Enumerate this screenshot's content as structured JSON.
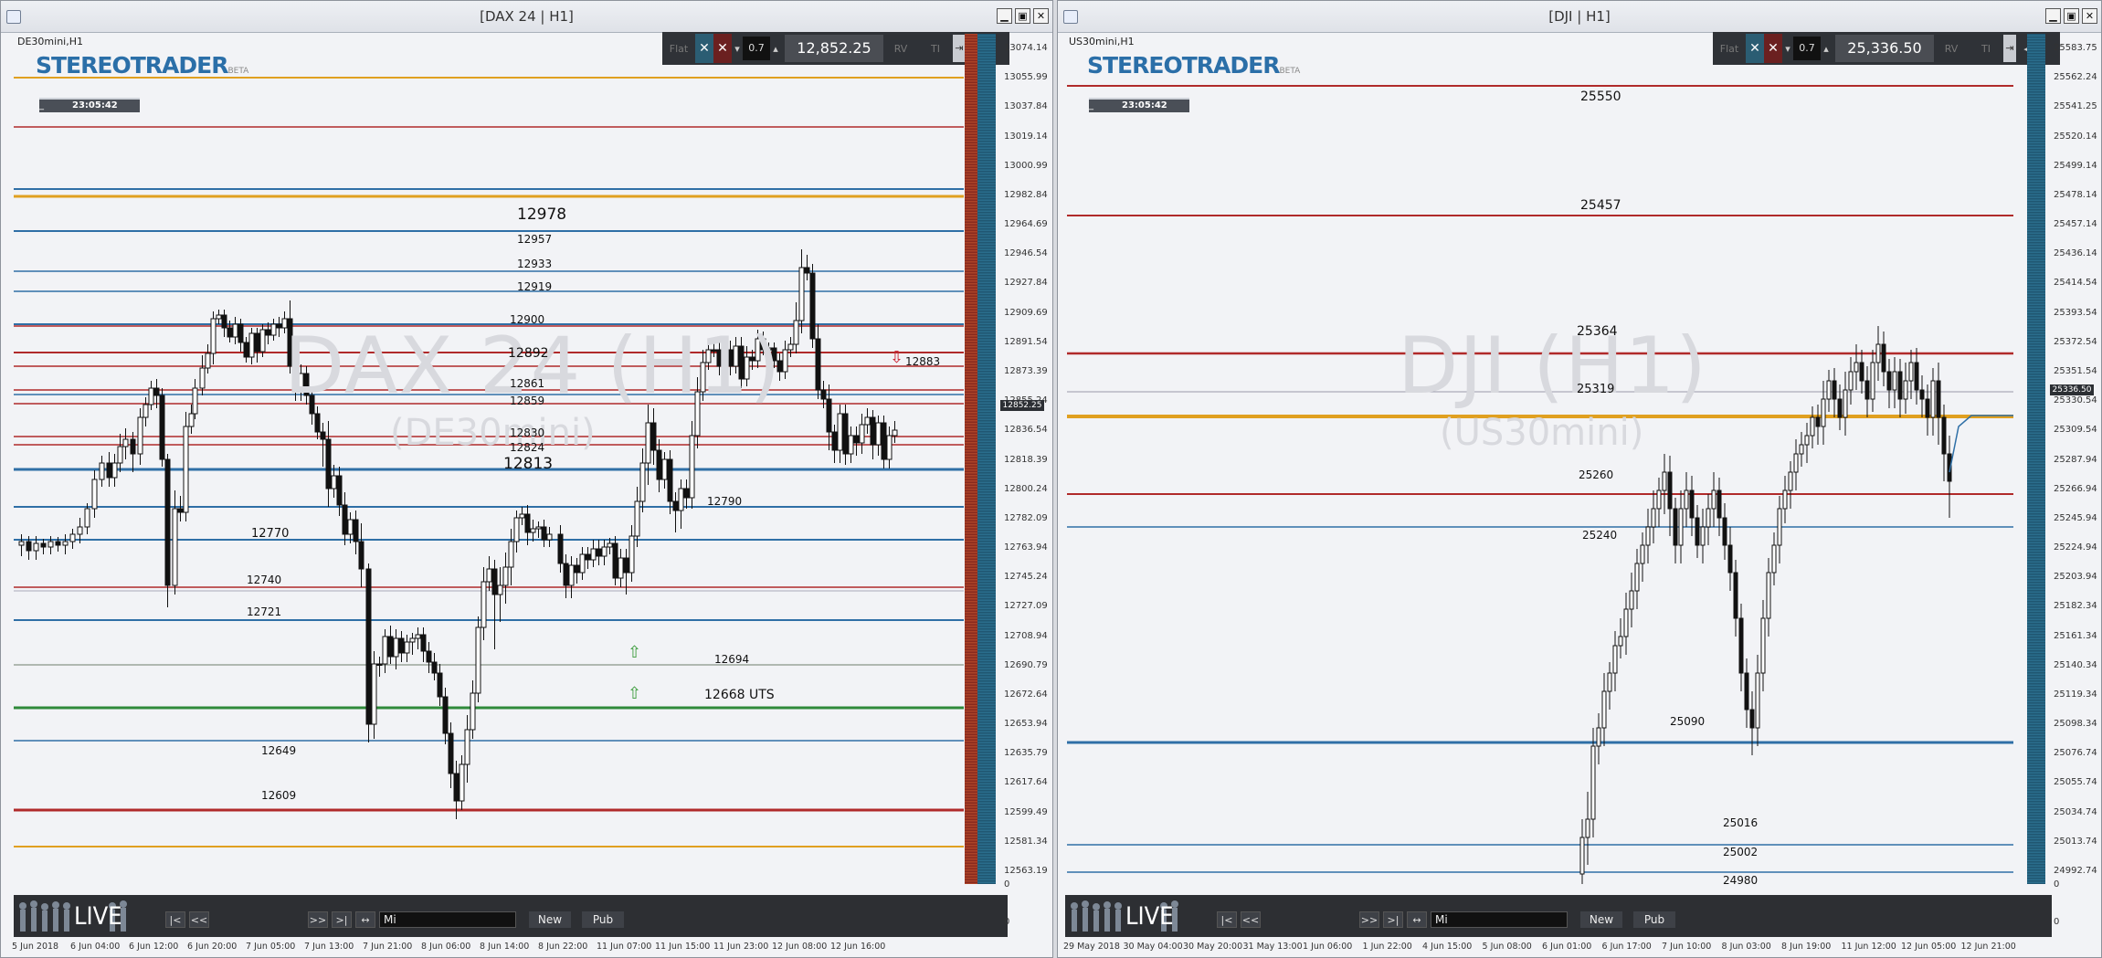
{
  "left": {
    "title": "[DAX 24 | H1]",
    "symbol": "DE30mini,H1",
    "watermark": "DAX 24 (H1)",
    "watermark_sub": "(DE30mini)",
    "logo_text": "STEREOTRADER",
    "logo_sub": "BETA",
    "clock": "23:05:42",
    "toolbar": {
      "flat": "Flat",
      "x1": "✕",
      "x2": "✕",
      "qty": "0.7",
      "price": "12,852.25",
      "rv": "RV",
      "ti": "TI"
    },
    "current_price_tag": "12852.25",
    "yaxis": [
      "13074.14",
      "13055.99",
      "13037.84",
      "13019.14",
      "13000.99",
      "12982.84",
      "12964.69",
      "12946.54",
      "12927.84",
      "12909.69",
      "12891.54",
      "12873.39",
      "12855.24",
      "12836.54",
      "12818.39",
      "12800.24",
      "12782.09",
      "12763.94",
      "12745.24",
      "12727.09",
      "12708.94",
      "12690.79",
      "12672.64",
      "12653.94",
      "12635.79",
      "12617.64",
      "12599.49",
      "12581.34",
      "12563.19"
    ],
    "levels": [
      {
        "value": "12978",
        "color": "#2f6fa6",
        "big": true
      },
      {
        "value": "12957",
        "color": "#2f6fa6"
      },
      {
        "value": "12933",
        "color": "#2f6fa6"
      },
      {
        "value": "12919",
        "color": "#2f6fa6"
      },
      {
        "value": "12900",
        "color": "#b02a2a"
      },
      {
        "value": "12892",
        "color": "#b02a2a"
      },
      {
        "value": "12883",
        "color": "#b02a2a"
      },
      {
        "value": "12861",
        "color": "#b02a2a"
      },
      {
        "value": "12859",
        "color": "#b02a2a"
      },
      {
        "value": "12830",
        "color": "#b02a2a"
      },
      {
        "value": "12824",
        "color": "#b02a2a"
      },
      {
        "value": "12813",
        "color": "#2f6fa6",
        "big": true
      },
      {
        "value": "12790",
        "color": "#2f6fa6"
      },
      {
        "value": "12770",
        "color": "#2f6fa6"
      },
      {
        "value": "12740",
        "color": "#b02a2a"
      },
      {
        "value": "12721",
        "color": "#2f6fa6"
      },
      {
        "value": "12694",
        "color": "#9aa49a"
      },
      {
        "value": "12668 UTS",
        "color": "#2f8a3a"
      },
      {
        "value": "12649",
        "color": "#2f6fa6"
      },
      {
        "value": "12609",
        "color": "#b02a2a"
      }
    ],
    "xaxis": [
      "5 Jun 2018",
      "6 Jun 04:00",
      "6 Jun 12:00",
      "6 Jun 20:00",
      "7 Jun 05:00",
      "7 Jun 13:00",
      "7 Jun 21:00",
      "8 Jun 06:00",
      "8 Jun 14:00",
      "8 Jun 22:00",
      "11 Jun 07:00",
      "11 Jun 15:00",
      "11 Jun 23:00",
      "12 Jun 08:00",
      "12 Jun 16:00"
    ],
    "bottom": {
      "live": "LIVE",
      "first": "|<",
      "prev": "<<",
      "next": ">>",
      "last": ">|",
      "expand": "↔",
      "input": "Mi",
      "new": "New",
      "pub": "Pub"
    },
    "gauge_values": [
      "0",
      "0"
    ]
  },
  "right": {
    "title": "[DJI | H1]",
    "symbol": "US30mini,H1",
    "watermark": "DJI (H1)",
    "watermark_sub": "(US30mini)",
    "logo_text": "STEREOTRADER",
    "logo_sub": "BETA",
    "clock": "23:05:42",
    "toolbar": {
      "flat": "Flat",
      "x1": "✕",
      "x2": "✕",
      "qty": "0.7",
      "price": "25,336.50",
      "rv": "RV",
      "ti": "TI"
    },
    "current_price_tag": "25336.50",
    "yaxis": [
      "25583.75",
      "25562.24",
      "25541.25",
      "25520.14",
      "25499.14",
      "25478.14",
      "25457.14",
      "25436.14",
      "25414.54",
      "25393.54",
      "25372.54",
      "25351.54",
      "25330.54",
      "25309.54",
      "25287.94",
      "25266.94",
      "25245.94",
      "25224.94",
      "25203.94",
      "25182.34",
      "25161.34",
      "25140.34",
      "25119.34",
      "25098.34",
      "25076.74",
      "25055.74",
      "25034.74",
      "25013.74",
      "24992.74"
    ],
    "levels": [
      {
        "value": "25550",
        "color": "#b02a2a"
      },
      {
        "value": "25457",
        "color": "#b02a2a"
      },
      {
        "value": "25364",
        "color": "#b02a2a"
      },
      {
        "value": "25319",
        "color": "#e0a020"
      },
      {
        "value": "25260",
        "color": "#b02a2a"
      },
      {
        "value": "25240",
        "color": "#2f6fa6"
      },
      {
        "value": "25090",
        "color": "#2f6fa6"
      },
      {
        "value": "25016",
        "color": "#2f6fa6"
      },
      {
        "value": "25002",
        "color": "#2f6fa6"
      },
      {
        "value": "24980",
        "color": "#2f6fa6"
      }
    ],
    "xaxis": [
      "29 May 2018",
      "30 May 04:00",
      "30 May 20:00",
      "31 May 13:00",
      "1 Jun 06:00",
      "1 Jun 22:00",
      "4 Jun 15:00",
      "5 Jun 08:00",
      "6 Jun 01:00",
      "6 Jun 17:00",
      "7 Jun 10:00",
      "8 Jun 03:00",
      "8 Jun 19:00",
      "11 Jun 12:00",
      "12 Jun 05:00",
      "12 Jun 21:00"
    ],
    "bottom": {
      "live": "LIVE",
      "first": "|<",
      "prev": "<<",
      "next": ">>",
      "last": ">|",
      "expand": "↔",
      "input": "Mi",
      "new": "New",
      "pub": "Pub"
    },
    "gauge_values": [
      "0",
      "0"
    ]
  },
  "colors": {
    "resistance": "#b02a2a",
    "support": "#2f6fa6",
    "gold": "#e0a020",
    "uts": "#2f8a3a",
    "gauge": "#2a6d8c"
  }
}
